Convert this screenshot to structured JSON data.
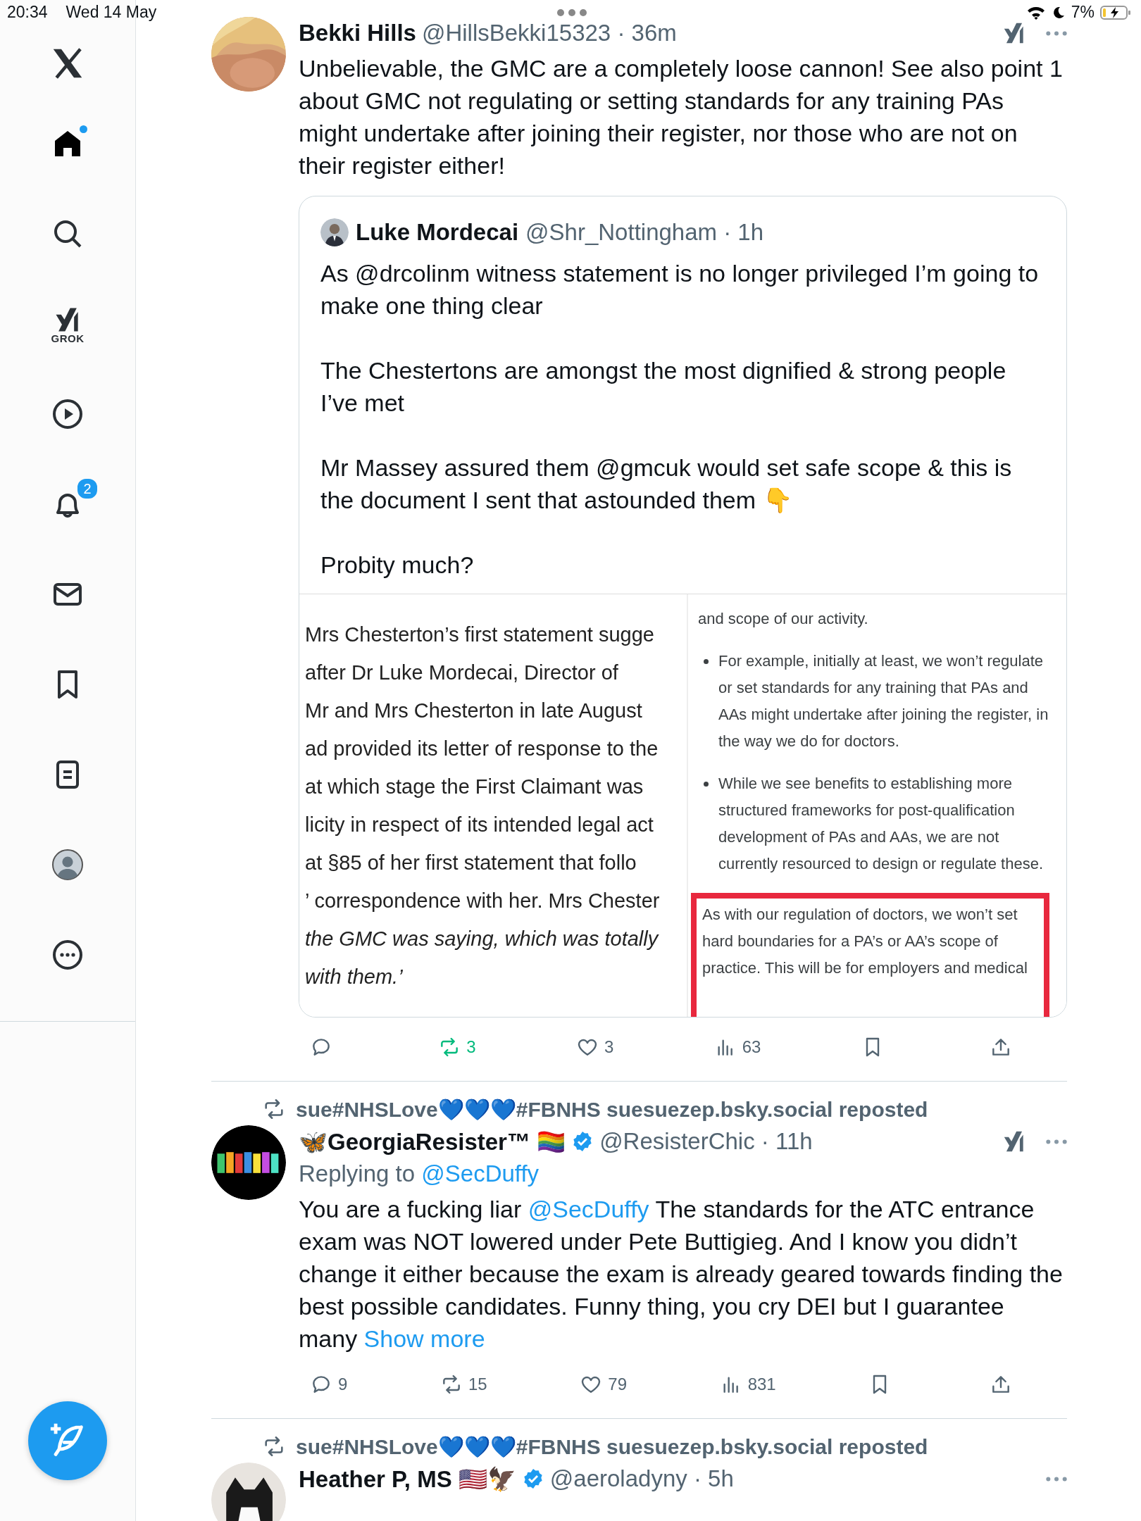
{
  "status_bar": {
    "time": "20:34",
    "date": "Wed 14 May",
    "battery": "7%",
    "charging": true
  },
  "sidebar": {
    "items": [
      {
        "kind": "logo",
        "selected": false,
        "dot": false
      },
      {
        "kind": "home",
        "selected": true,
        "dot": true
      },
      {
        "kind": "search",
        "selected": false,
        "dot": false
      },
      {
        "kind": "grok",
        "selected": false,
        "dot": false,
        "label": "GROK"
      },
      {
        "kind": "video",
        "selected": false,
        "dot": false
      },
      {
        "kind": "notifications",
        "selected": false,
        "dot": false,
        "badge": "2"
      },
      {
        "kind": "messages",
        "selected": false,
        "dot": false
      },
      {
        "kind": "bookmarks",
        "selected": false,
        "dot": false
      },
      {
        "kind": "lists",
        "selected": false,
        "dot": false
      },
      {
        "kind": "profile",
        "selected": false,
        "dot": false
      },
      {
        "kind": "more",
        "selected": false,
        "dot": false
      }
    ]
  },
  "feed": [
    {
      "author": "Bekki Hills",
      "verified": false,
      "meta": "@HillsBekki15323 · 36m",
      "text": [
        {
          "kind": "plain",
          "text": "Unbelievable, the GMC are a completely loose cannon! See also point 1 about GMC not regulating or setting standards for any training PAs might undertake after joining their register, nor those who are not on their register either!"
        }
      ],
      "quote": {
        "author": "Luke Mordecai",
        "meta": "@Shr_Nottingham · 1h",
        "paragraphs": [
          "As @drcolinm witness statement is no longer privileged I’m going to make one thing clear",
          "The Chestertons are amongst the most dignified & strong people I’ve met",
          "Mr Massey assured them @gmcuk would set safe scope & this is the document I sent that astounded them 👇",
          "Probity much?"
        ],
        "media": {
          "left_lines": [
            {
              "text": "Mrs Chesterton’s first statement sugge",
              "italic": false
            },
            {
              "text": "after Dr Luke Mordecai, Director of",
              "italic": false
            },
            {
              "text": "Mr and Mrs Chesterton in late August",
              "italic": false
            },
            {
              "text": "ad provided its letter of response to the",
              "italic": false
            },
            {
              "text": "at which stage the First Claimant was",
              "italic": false
            },
            {
              "text": "licity in respect of its intended legal act",
              "italic": false
            },
            {
              "text": "at §85 of her first statement that follo",
              "italic": false
            },
            {
              "text": "’ correspondence with her. Mrs Chester",
              "italic": false
            },
            {
              "text": "the GMC was saying, which was totally",
              "italic": true
            },
            {
              "text": "with them.’",
              "italic": true
            }
          ],
          "right_blocks": [
            {
              "kind": "para",
              "text": "and scope of our activity."
            },
            {
              "kind": "bullet",
              "text": "For example, initially at least, we won’t regulate or set standards for any training that PAs and AAs might undertake after joining the register, in the way we do for doctors."
            },
            {
              "kind": "bullet",
              "text": "While we see benefits to establishing more structured frameworks for post-qualification development of PAs and AAs, we are not currently resourced to design or regulate these."
            },
            {
              "kind": "highlight",
              "text": "As with our regulation of doctors, we won’t set hard boundaries for a PA’s or AA’s scope of practice. This will be for employers and medical"
            }
          ]
        }
      },
      "actions": [
        {
          "kind": "reply"
        },
        {
          "kind": "repost",
          "count": "3",
          "on": true
        },
        {
          "kind": "like",
          "count": "3",
          "on": false
        },
        {
          "kind": "views",
          "count": "63"
        },
        {
          "kind": "bookmark",
          "on": false
        },
        {
          "kind": "share"
        }
      ]
    },
    {
      "reposted_by": "sue#NHSLove💙💙💙#FBNHS suesuezep.bsky.social reposted",
      "author": "🦋GeorgiaResister™ 🏳️‍🌈",
      "verified": true,
      "meta": "@ResisterChic · 11h",
      "replying_to": {
        "label": "Replying to",
        "handle": "@SecDuffy"
      },
      "text": [
        {
          "kind": "plain",
          "text": "You are a fucking liar "
        },
        {
          "kind": "mention",
          "text": "@SecDuffy"
        },
        {
          "kind": "plain",
          "text": " The standards for the ATC entrance exam was NOT lowered under Pete Buttigieg. And I know you didn’t change it either because the exam is already geared towards finding the best possible candidates. Funny thing, you cry DEI but I guarantee many "
        },
        {
          "kind": "more",
          "text": "Show more"
        }
      ],
      "actions": [
        {
          "kind": "reply",
          "count": "9"
        },
        {
          "kind": "repost",
          "count": "15",
          "on": false
        },
        {
          "kind": "like",
          "count": "79",
          "on": false
        },
        {
          "kind": "views",
          "count": "831"
        },
        {
          "kind": "bookmark",
          "on": false
        },
        {
          "kind": "share"
        }
      ]
    },
    {
      "reposted_by": "sue#NHSLove💙💙💙#FBNHS suesuezep.bsky.social reposted",
      "author": "Heather P, MS 🇺🇸🦅",
      "verified": true,
      "meta": "@aeroladyny · 5h"
    }
  ]
}
